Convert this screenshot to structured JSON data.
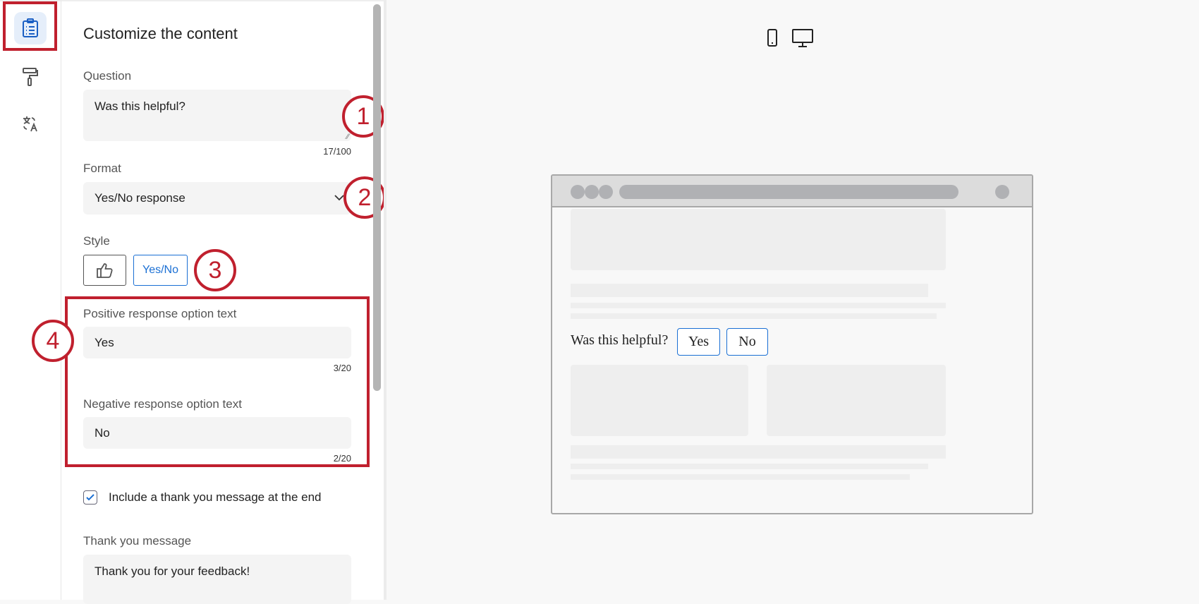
{
  "rail": {
    "items": [
      {
        "name": "content",
        "active": true
      },
      {
        "name": "style"
      },
      {
        "name": "translate"
      }
    ]
  },
  "panel": {
    "title": "Customize the content",
    "question": {
      "label": "Question",
      "value": "Was this helpful?",
      "count": "17/100"
    },
    "format": {
      "label": "Format",
      "value": "Yes/No response"
    },
    "style": {
      "label": "Style",
      "options": [
        "thumbs",
        "Yes/No"
      ],
      "selected": "Yes/No"
    },
    "positive": {
      "label": "Positive response option text",
      "value": "Yes",
      "count": "3/20"
    },
    "negative": {
      "label": "Negative response option text",
      "value": "No",
      "count": "2/20"
    },
    "thank_checkbox": {
      "label": "Include a thank you message at the end",
      "checked": true
    },
    "thank_message": {
      "label": "Thank you message",
      "value": "Thank you for your feedback!"
    }
  },
  "annotations": [
    "1",
    "2",
    "3",
    "4"
  ],
  "preview": {
    "question": "Was this helpful?",
    "yes": "Yes",
    "no": "No"
  },
  "colors": {
    "accent": "#1a6fd4",
    "annotation": "#c0202e"
  }
}
